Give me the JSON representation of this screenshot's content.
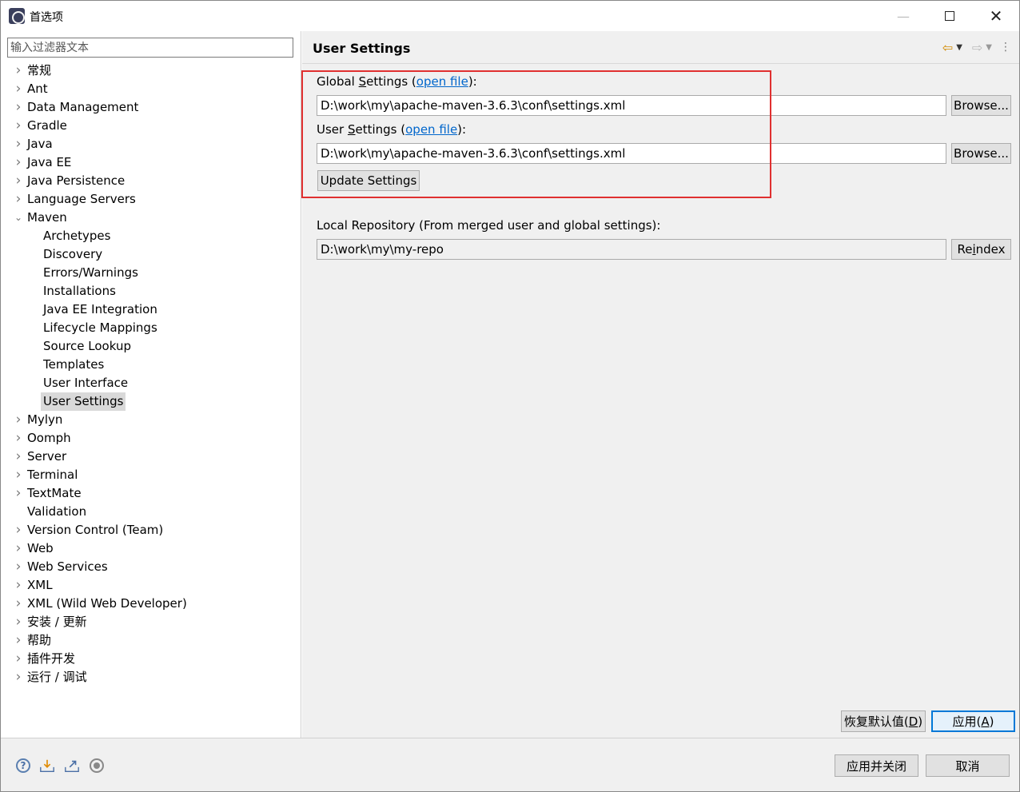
{
  "window": {
    "title": "首选项"
  },
  "filter": {
    "placeholder": "输入过滤器文本"
  },
  "tree": [
    {
      "label": "常规",
      "chevron": "right",
      "child": false,
      "selected": false
    },
    {
      "label": "Ant",
      "chevron": "right",
      "child": false,
      "selected": false
    },
    {
      "label": "Data Management",
      "chevron": "right",
      "child": false,
      "selected": false
    },
    {
      "label": "Gradle",
      "chevron": "right",
      "child": false,
      "selected": false
    },
    {
      "label": "Java",
      "chevron": "right",
      "child": false,
      "selected": false
    },
    {
      "label": "Java EE",
      "chevron": "right",
      "child": false,
      "selected": false
    },
    {
      "label": "Java Persistence",
      "chevron": "right",
      "child": false,
      "selected": false
    },
    {
      "label": "Language Servers",
      "chevron": "right",
      "child": false,
      "selected": false
    },
    {
      "label": "Maven",
      "chevron": "down",
      "child": false,
      "selected": false
    },
    {
      "label": "Archetypes",
      "chevron": "",
      "child": true,
      "selected": false
    },
    {
      "label": "Discovery",
      "chevron": "",
      "child": true,
      "selected": false
    },
    {
      "label": "Errors/Warnings",
      "chevron": "",
      "child": true,
      "selected": false
    },
    {
      "label": "Installations",
      "chevron": "",
      "child": true,
      "selected": false
    },
    {
      "label": "Java EE Integration",
      "chevron": "",
      "child": true,
      "selected": false
    },
    {
      "label": "Lifecycle Mappings",
      "chevron": "",
      "child": true,
      "selected": false
    },
    {
      "label": "Source Lookup",
      "chevron": "",
      "child": true,
      "selected": false
    },
    {
      "label": "Templates",
      "chevron": "",
      "child": true,
      "selected": false
    },
    {
      "label": "User Interface",
      "chevron": "",
      "child": true,
      "selected": false
    },
    {
      "label": "User Settings",
      "chevron": "",
      "child": true,
      "selected": true
    },
    {
      "label": "Mylyn",
      "chevron": "right",
      "child": false,
      "selected": false
    },
    {
      "label": "Oomph",
      "chevron": "right",
      "child": false,
      "selected": false
    },
    {
      "label": "Server",
      "chevron": "right",
      "child": false,
      "selected": false
    },
    {
      "label": "Terminal",
      "chevron": "right",
      "child": false,
      "selected": false
    },
    {
      "label": "TextMate",
      "chevron": "right",
      "child": false,
      "selected": false
    },
    {
      "label": "Validation",
      "chevron": "",
      "child": false,
      "selected": false
    },
    {
      "label": "Version Control (Team)",
      "chevron": "right",
      "child": false,
      "selected": false
    },
    {
      "label": "Web",
      "chevron": "right",
      "child": false,
      "selected": false
    },
    {
      "label": "Web Services",
      "chevron": "right",
      "child": false,
      "selected": false
    },
    {
      "label": "XML",
      "chevron": "right",
      "child": false,
      "selected": false
    },
    {
      "label": "XML (Wild Web Developer)",
      "chevron": "right",
      "child": false,
      "selected": false
    },
    {
      "label": "安装 / 更新",
      "chevron": "right",
      "child": false,
      "selected": false
    },
    {
      "label": "帮助",
      "chevron": "right",
      "child": false,
      "selected": false
    },
    {
      "label": "插件开发",
      "chevron": "right",
      "child": false,
      "selected": false
    },
    {
      "label": "运行 / 调试",
      "chevron": "right",
      "child": false,
      "selected": false
    }
  ],
  "page": {
    "title": "User Settings",
    "global_label_prefix": "Global ",
    "global_label_mnemonic": "S",
    "global_label_rest": "ettings (",
    "global_link": "open file",
    "global_label_suffix": "):",
    "global_path": "D:\\work\\my\\apache-maven-3.6.3\\conf\\settings.xml",
    "user_label_prefix": "User ",
    "user_label_mnemonic": "S",
    "user_label_rest": "ettings (",
    "user_link": "open file",
    "user_label_suffix": "):",
    "user_path": "D:\\work\\my\\apache-maven-3.6.3\\conf\\settings.xml",
    "browse_label": "Browse...",
    "update_label": "Update Settings",
    "local_repo_label": "Local Repository (From merged user and global settings):",
    "local_repo_path": "D:\\work\\my\\my-repo",
    "reindex_prefix": "Re",
    "reindex_mnemonic": "i",
    "reindex_rest": "ndex",
    "restore_defaults_prefix": "恢复默认值(",
    "restore_defaults_mnemonic": "D",
    "restore_defaults_suffix": ")",
    "apply_prefix": "应用(",
    "apply_mnemonic": "A",
    "apply_suffix": ")"
  },
  "footer": {
    "apply_close_label": "应用并关闭",
    "cancel_label": "取消",
    "help_glyph": "?"
  },
  "colors": {
    "highlight": "#e03030",
    "link": "#0066cc",
    "selection": "#d9d9d9"
  }
}
